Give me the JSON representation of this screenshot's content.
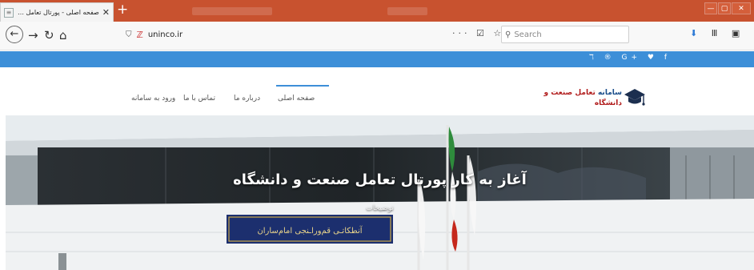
{
  "browser": {
    "tab_title": "صفحه اصلی - پورتال تعامل صنعت و دانشگاه",
    "tab_close": "✕",
    "new_tab": "+",
    "window_controls": [
      "—",
      "▢",
      "✕"
    ],
    "url": "uninco.ir",
    "url_actions": "··· ☑ ☆",
    "search_placeholder": "Search",
    "search_icon": "search-icon",
    "toolbar_icons": "⬇ Ⅲ ▣ ◉ ≡"
  },
  "site": {
    "social_icons": "ℸ ® G+ ♥ f",
    "logo": {
      "line1_a": "سامانه ",
      "line1_b": "تعامل صنعت و",
      "line2": "دانشگاه"
    },
    "menu": {
      "home": "صفحه اصلی",
      "about": "درباره ما",
      "contact": "تماس با ما",
      "login": "ورود به سامانه"
    },
    "hero": {
      "title": "آغاز به کار پورتال تعامل صنعت و دانشگاه",
      "subtitle": "توضیحات",
      "banner_text": "آنطکاتـی قم‌وراـنجی امام‌ساران"
    }
  },
  "colors": {
    "tabstrip": "#c8522f",
    "site_accent": "#3d8fd8",
    "logo_blue": "#1a4d8a",
    "logo_red": "#b11c1c"
  }
}
